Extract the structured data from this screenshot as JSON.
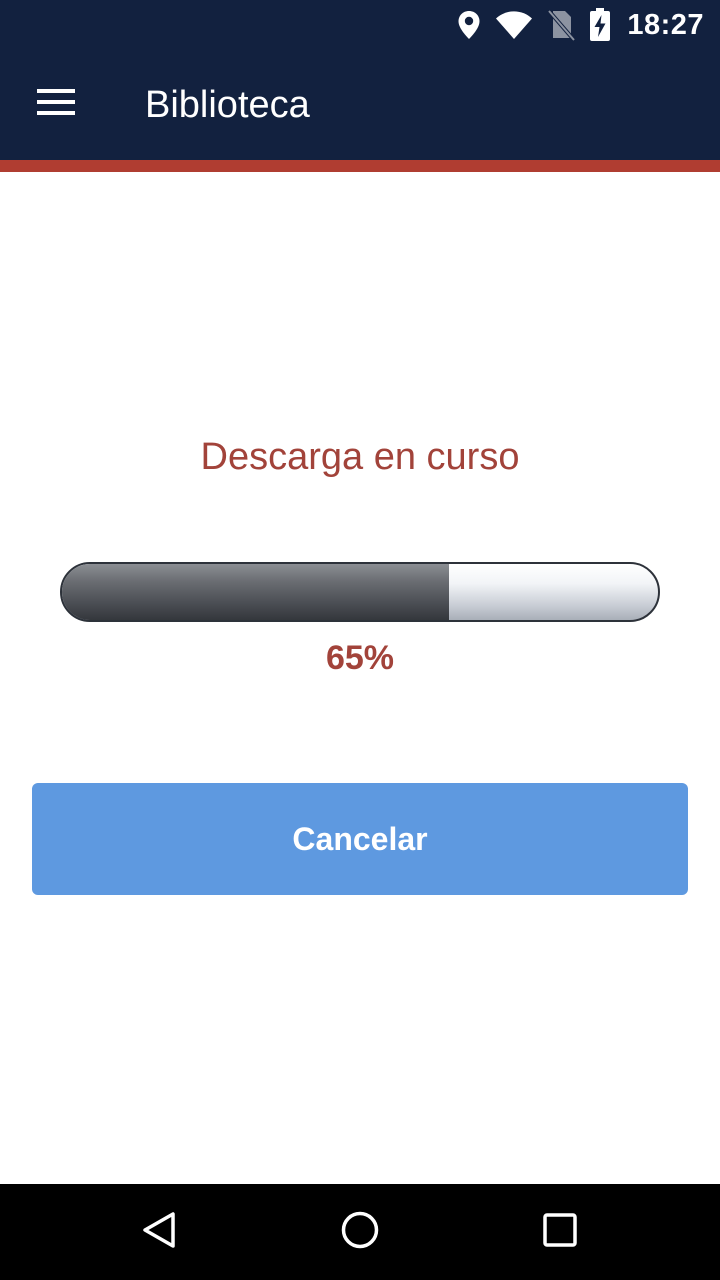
{
  "status_bar": {
    "time": "18:27",
    "icons": [
      "location-icon",
      "wifi-icon",
      "no-sim-icon",
      "battery-charging-icon"
    ]
  },
  "app_bar": {
    "title": "Biblioteca",
    "menu_icon": "hamburger-menu-icon"
  },
  "download": {
    "heading": "Descarga en curso",
    "progress": 0.65,
    "percent_label": "65%"
  },
  "actions": {
    "cancel_label": "Cancelar"
  },
  "nav_bar": {
    "icons": [
      "back-icon",
      "home-icon",
      "recents-icon"
    ]
  },
  "colors": {
    "header": "#12213f",
    "accent": "#b03d31",
    "text_accent": "#a2433a",
    "button": "#5e99e0"
  }
}
